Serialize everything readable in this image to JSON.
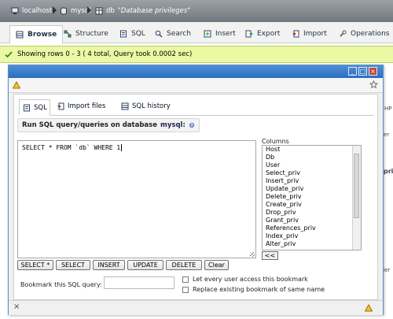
{
  "breadcrumb": {
    "server": "localhost",
    "database": "mysql",
    "table_label": "db",
    "table_comment": "\"Database privileges\""
  },
  "tabs": [
    {
      "label": "Browse",
      "icon": "browse-icon",
      "active": true
    },
    {
      "label": "Structure",
      "icon": "structure-icon"
    },
    {
      "label": "SQL",
      "icon": "sql-icon"
    },
    {
      "label": "Search",
      "icon": "search-icon"
    },
    {
      "label": "Insert",
      "icon": "insert-icon"
    },
    {
      "label": "Export",
      "icon": "export-icon"
    },
    {
      "label": "Import",
      "icon": "import-icon"
    },
    {
      "label": "Operations",
      "icon": "operations-icon"
    }
  ],
  "success_message": "Showing rows 0 - 3 ( 4 total, Query took 0.0002 sec)",
  "background_fragments": {
    "right_top": "HP",
    "right_mid": "ler",
    "right_low": "priv",
    "right_bottom": "ler"
  },
  "dialog": {
    "query_tabs": [
      {
        "label": "SQL",
        "icon": "sql-icon",
        "active": true
      },
      {
        "label": "Import files",
        "icon": "import-files-icon"
      },
      {
        "label": "SQL history",
        "icon": "sql-history-icon"
      }
    ],
    "run_label_prefix": "Run SQL query/queries on database",
    "run_label_db": "mysql:",
    "query_text": "SELECT * FROM `db` WHERE 1",
    "columns_label": "Columns",
    "columns": [
      "Host",
      "Db",
      "User",
      "Select_priv",
      "Insert_priv",
      "Update_priv",
      "Delete_priv",
      "Create_priv",
      "Drop_priv",
      "Grant_priv",
      "References_priv",
      "Index_priv",
      "Alter_priv"
    ],
    "insert_column_button": "<<",
    "buttons": [
      "SELECT *",
      "SELECT",
      "INSERT",
      "UPDATE",
      "DELETE",
      "Clear"
    ],
    "bookmark_label": "Bookmark this SQL query:",
    "bookmark_value": "",
    "checkbox_every_user": "Let every user access this bookmark",
    "checkbox_replace": "Replace existing bookmark of same name"
  },
  "colors": {
    "titlebar": "#6f777d",
    "success_bg": "#ebf8a4",
    "dialog_title": "#2c6cc0"
  }
}
